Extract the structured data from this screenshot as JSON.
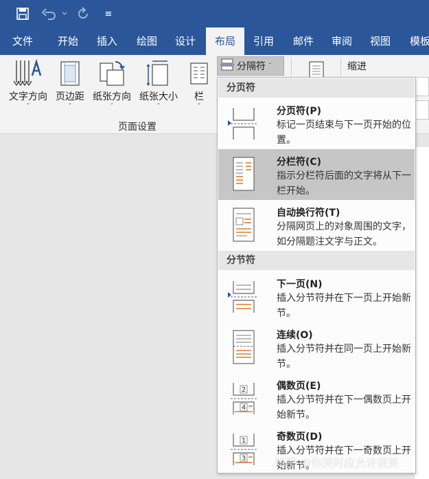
{
  "quick_access": {
    "customize_glyph": "≡"
  },
  "tabs": [
    {
      "label": "文件"
    },
    {
      "label": "开始"
    },
    {
      "label": "插入"
    },
    {
      "label": "绘图"
    },
    {
      "label": "设计"
    },
    {
      "label": "布局",
      "active": true
    },
    {
      "label": "引用"
    },
    {
      "label": "邮件"
    },
    {
      "label": "审阅"
    },
    {
      "label": "视图"
    },
    {
      "label": "模板"
    }
  ],
  "ribbon": {
    "buttons": [
      {
        "label": "文字方向",
        "icon": "text-direction-icon"
      },
      {
        "label": "页边距",
        "icon": "margins-icon"
      },
      {
        "label": "纸张方向",
        "icon": "orientation-icon"
      },
      {
        "label": "纸张大小",
        "icon": "size-icon"
      },
      {
        "label": "栏",
        "icon": "columns-icon"
      }
    ],
    "caret": "ˇ",
    "group_label": "页面设置",
    "breaks_label": "分隔符",
    "indent_label": "缩进"
  },
  "dropdown": {
    "page_breaks_header": "分页符",
    "section_breaks_header": "分节符",
    "items": [
      {
        "title": "分页符(P)",
        "desc": "标记一页结束与下一页开始的位置。",
        "icon": "page-break-icon",
        "selected": false
      },
      {
        "title": "分栏符(C)",
        "desc": "指示分栏符后面的文字将从下一栏开始。",
        "icon": "column-break-icon",
        "selected": true
      },
      {
        "title": "自动换行符(T)",
        "desc": "分隔网页上的对象周围的文字，如分隔题注文字与正文。",
        "icon": "text-wrapping-icon",
        "selected": false
      },
      {
        "title": "下一页(N)",
        "desc": "插入分节符并在下一页上开始新节。",
        "icon": "next-page-icon",
        "selected": false
      },
      {
        "title": "连续(O)",
        "desc": "插入分节符并在同一页上开始新节。",
        "icon": "continuous-icon",
        "selected": false
      },
      {
        "title": "偶数页(E)",
        "desc": "插入分节符并在下一偶数页上开始新节。",
        "icon": "even-page-icon",
        "icon_numbers": [
          "2",
          "4"
        ],
        "selected": false
      },
      {
        "title": "奇数页(D)",
        "desc": "插入分节符并在下一奇数页上开始新节。",
        "icon": "odd-page-icon",
        "icon_numbers": [
          "1",
          "3"
        ],
        "selected": false
      }
    ]
  },
  "watermark": "知乎 @你哭时应允许我笑",
  "colors": {
    "brand": "#2b579a",
    "ribbon_bg": "#f3f3f3",
    "selected_item": "#c6c6c6",
    "icon_accent": "#e07b2a"
  }
}
